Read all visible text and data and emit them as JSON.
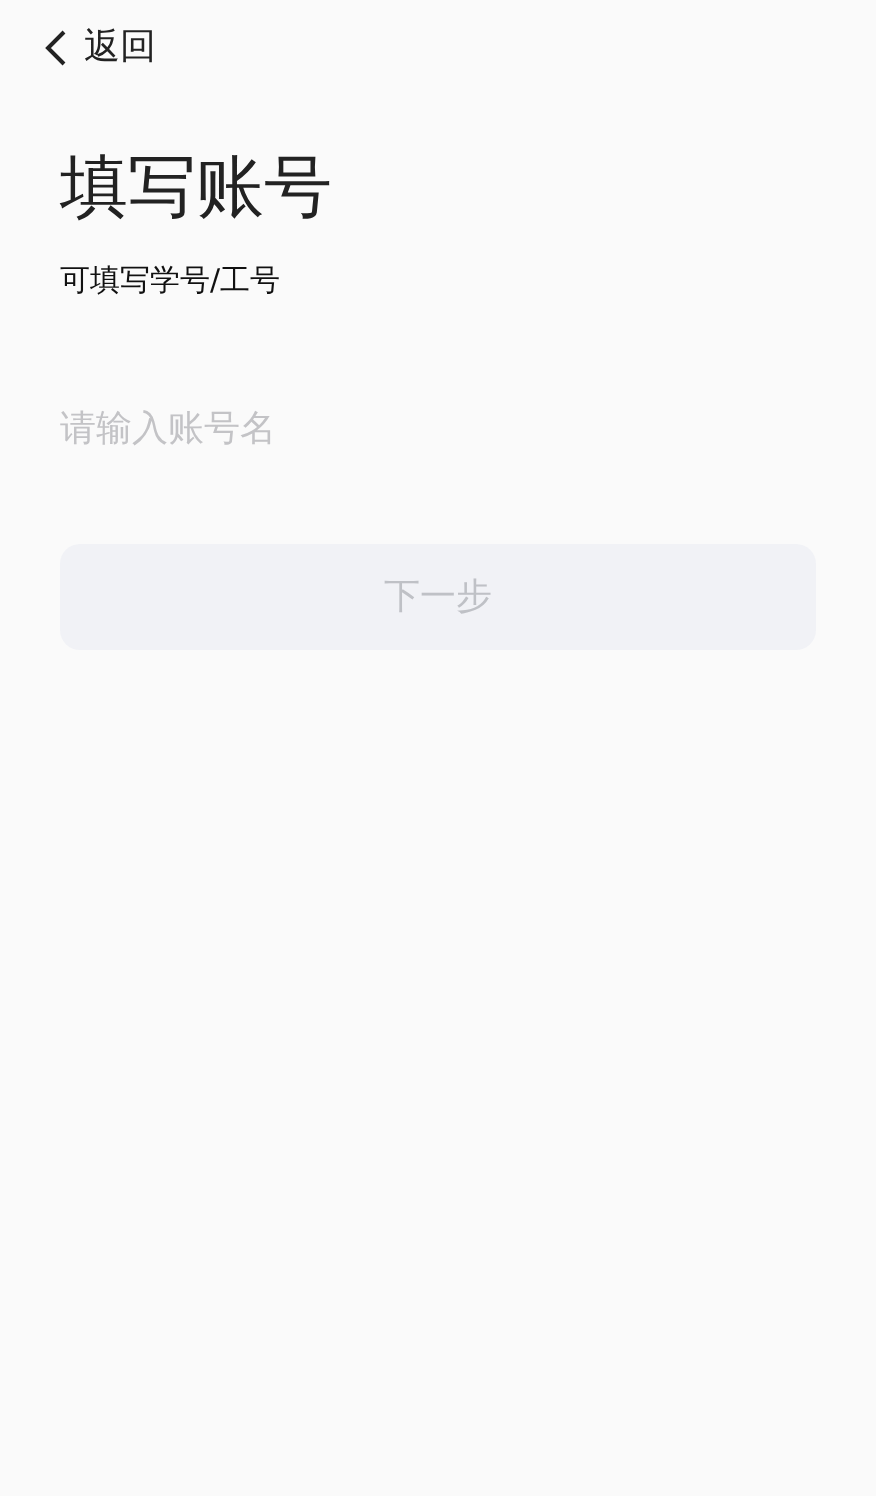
{
  "header": {
    "back_label": "返回"
  },
  "title": "填写账号",
  "subtitle": "可填写学号/工号",
  "account_field": {
    "placeholder": "请输入账号名"
  },
  "next_button": {
    "label": "下一步",
    "disabled": true
  }
}
